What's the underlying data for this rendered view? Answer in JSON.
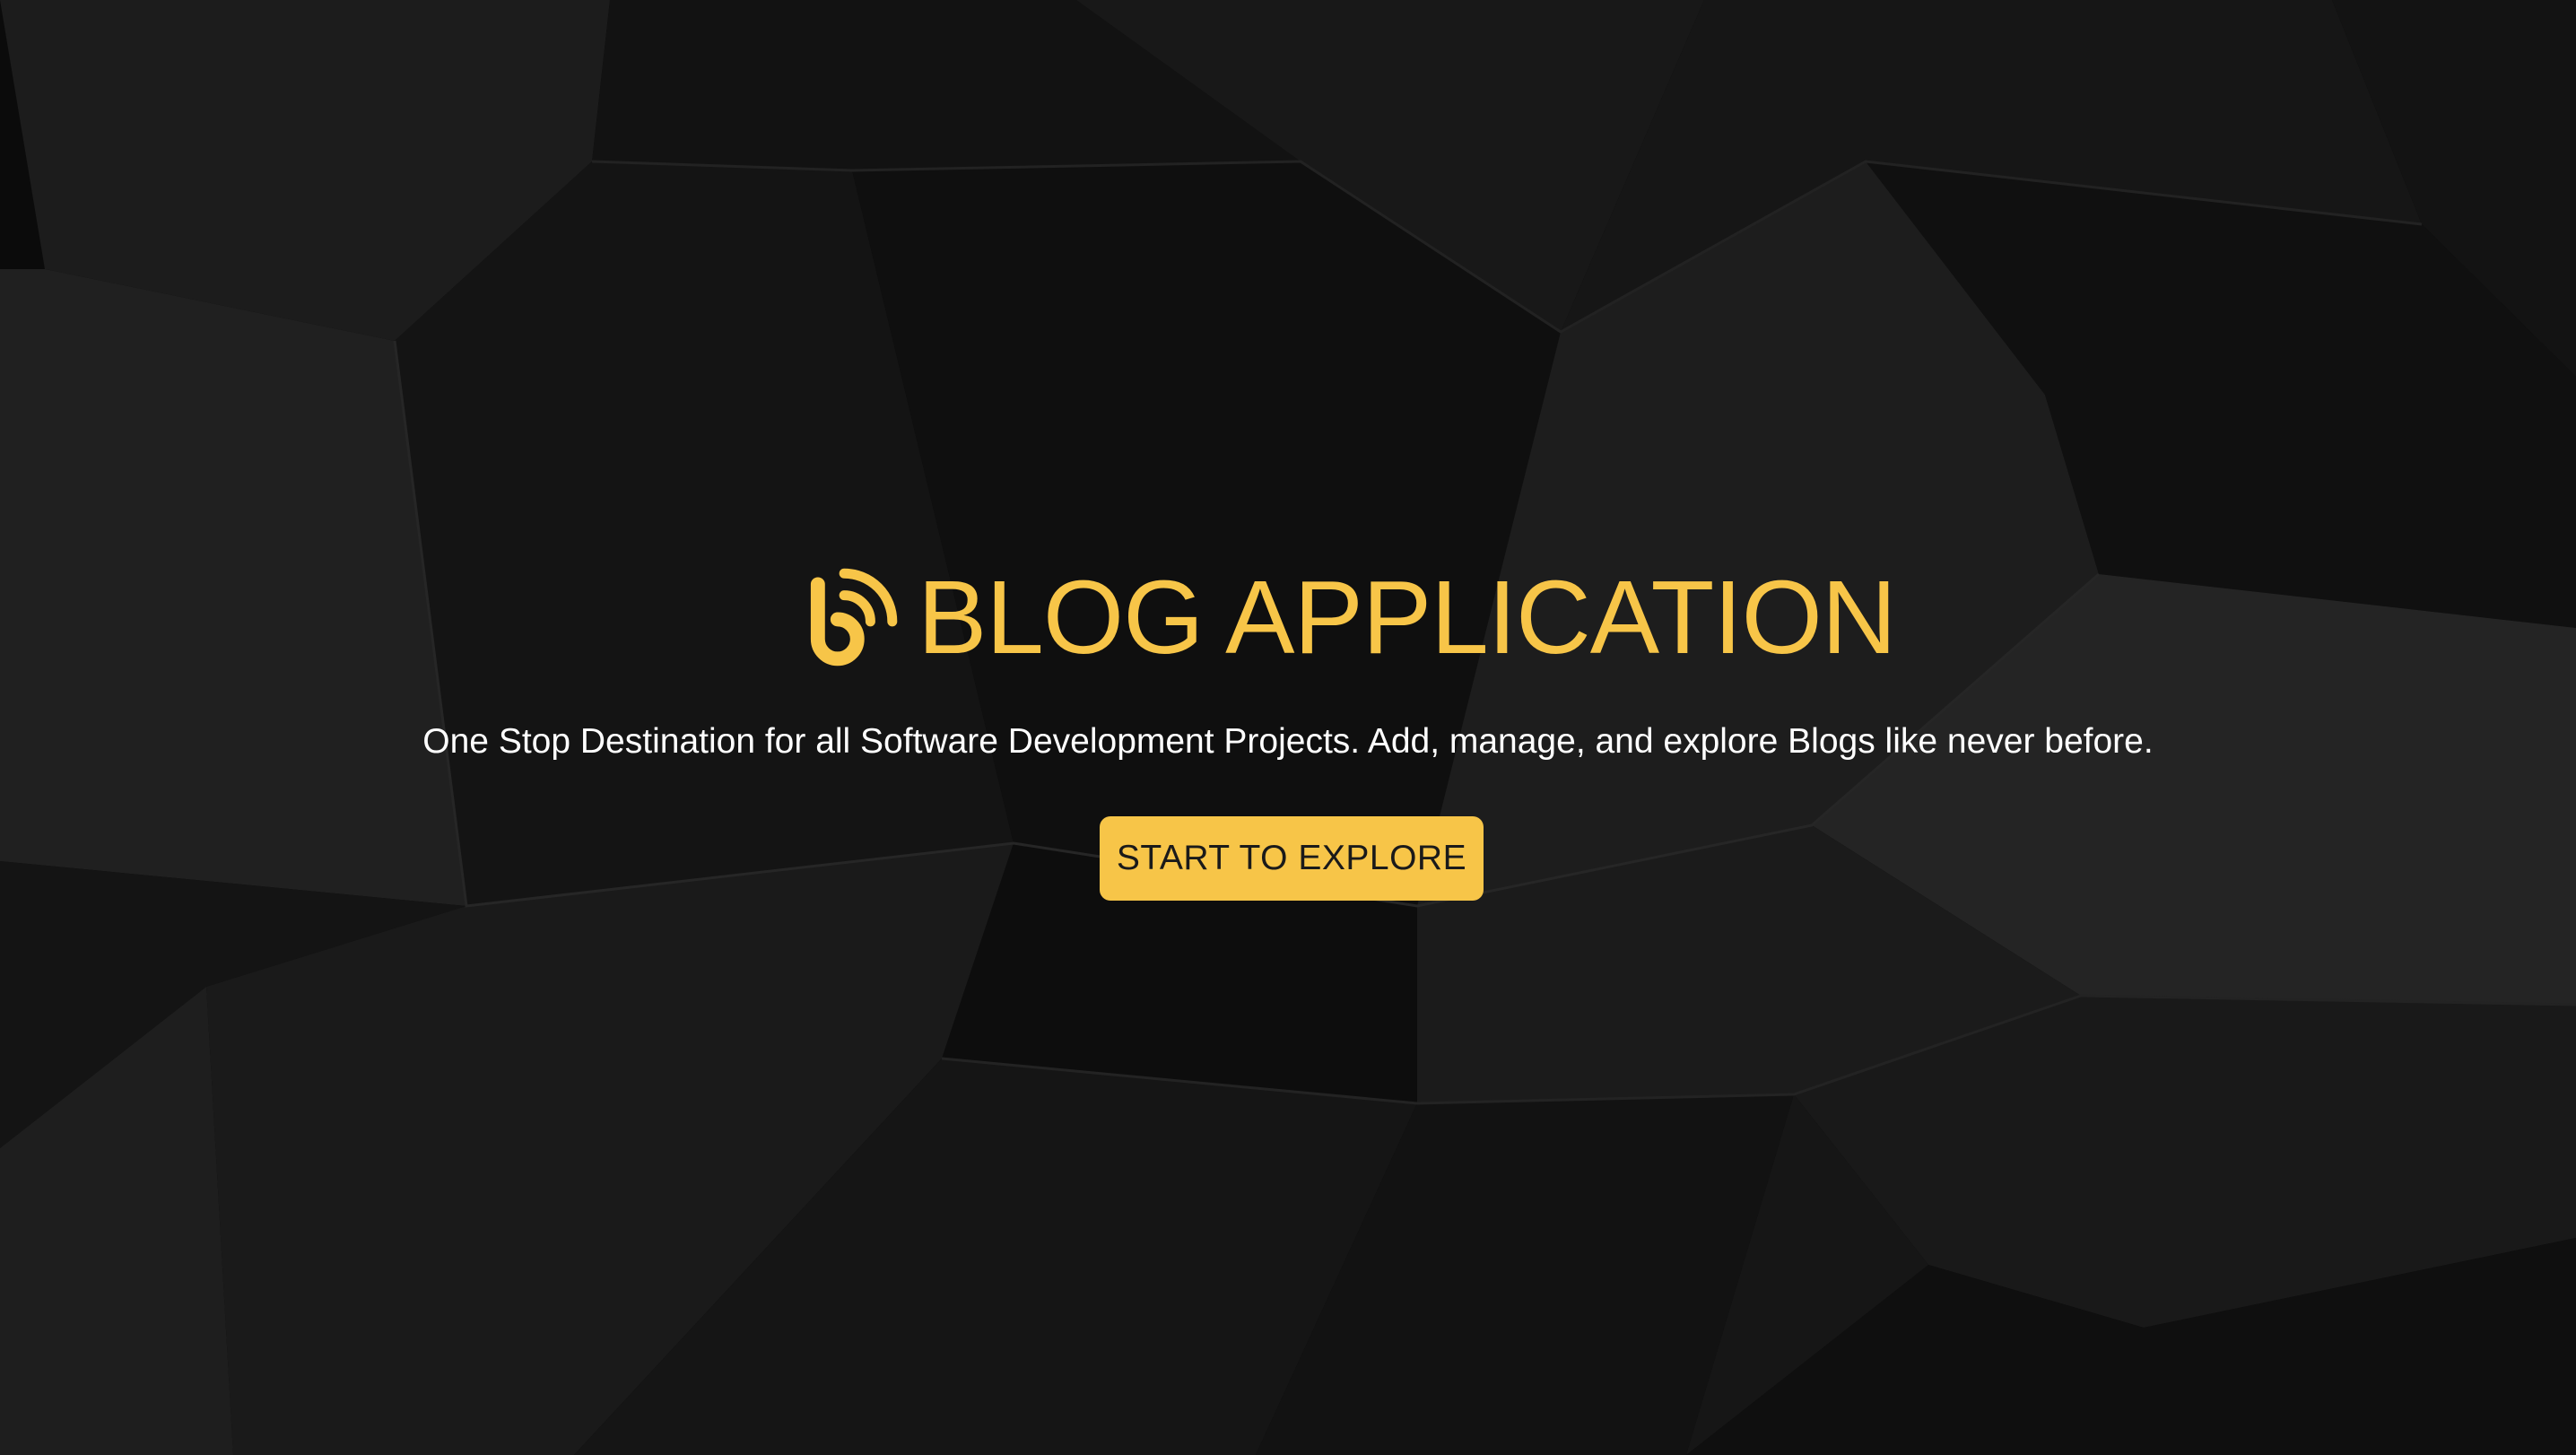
{
  "hero": {
    "logo_icon": "blog-rss-icon",
    "title": "BLOG APPLICATION",
    "subtitle": "One Stop Destination for all Software Development Projects. Add, manage, and explore Blogs like never before.",
    "cta_label": "START TO EXPLORE"
  },
  "colors": {
    "accent": "#f7c548",
    "background": "#0b0b0b",
    "text": "#ffffff",
    "button_text": "#1a1a1a"
  }
}
